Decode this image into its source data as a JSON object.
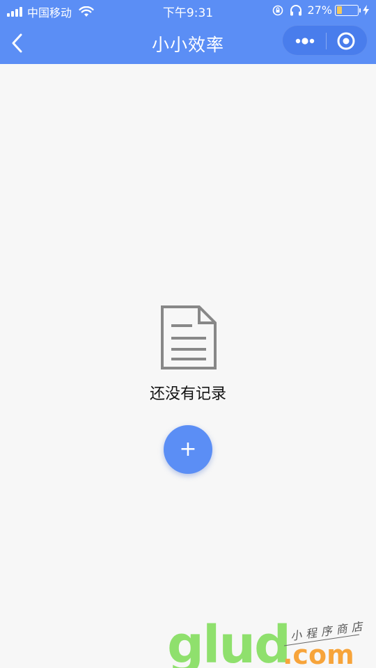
{
  "status_bar": {
    "carrier": "中国移动",
    "time": "下午9:31",
    "battery_percent_label": "27%",
    "battery_level": 0.27
  },
  "nav": {
    "title": "小小效率",
    "back_icon": "chevron-left-icon",
    "more_icon": "more-dots-icon",
    "close_icon": "target-circle-icon"
  },
  "empty_state": {
    "icon": "document-icon",
    "message": "还没有记录"
  },
  "fab": {
    "label": "+"
  },
  "watermark": {
    "brand": "glud",
    "domain": ".com",
    "tagline": "小程序商店"
  },
  "colors": {
    "primary": "#5b8ef5",
    "background": "#f7f7f7",
    "watermark_green": "#8fe06d",
    "watermark_orange": "#f7a43a"
  }
}
